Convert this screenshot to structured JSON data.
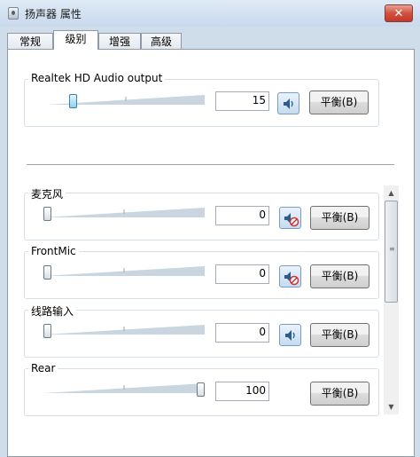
{
  "window": {
    "title": "扬声器 属性",
    "close_glyph": "✕"
  },
  "tabs": [
    {
      "label": "常规",
      "active": false
    },
    {
      "label": "级别",
      "active": true
    },
    {
      "label": "增强",
      "active": false
    },
    {
      "label": "高级",
      "active": false
    }
  ],
  "master": {
    "label": "Realtek HD Audio output",
    "value": "15",
    "level": 0.15,
    "muted": false,
    "balance_label": "平衡(B)"
  },
  "channels": [
    {
      "label": "麦克风",
      "value": "0",
      "level": 0,
      "muted": true,
      "has_speaker": true,
      "balance_label": "平衡(B)"
    },
    {
      "label": "FrontMic",
      "value": "0",
      "level": 0,
      "muted": true,
      "has_speaker": true,
      "balance_label": "平衡(B)"
    },
    {
      "label": "线路输入",
      "value": "0",
      "level": 0,
      "muted": false,
      "has_speaker": true,
      "balance_label": "平衡(B)"
    },
    {
      "label": "Rear",
      "value": "100",
      "level": 1.0,
      "muted": false,
      "has_speaker": false,
      "balance_label": "平衡(B)"
    }
  ],
  "icons": {
    "speaker": "speaker-icon",
    "muted_speaker": "speaker-muted-icon",
    "close": "close-icon",
    "app": "speaker-properties-icon"
  },
  "colors": {
    "titlebar": "#cfdcea",
    "close_button": "#c9402e",
    "thumb_active": "#8cd0f0",
    "mute_badge": "#d03030"
  }
}
